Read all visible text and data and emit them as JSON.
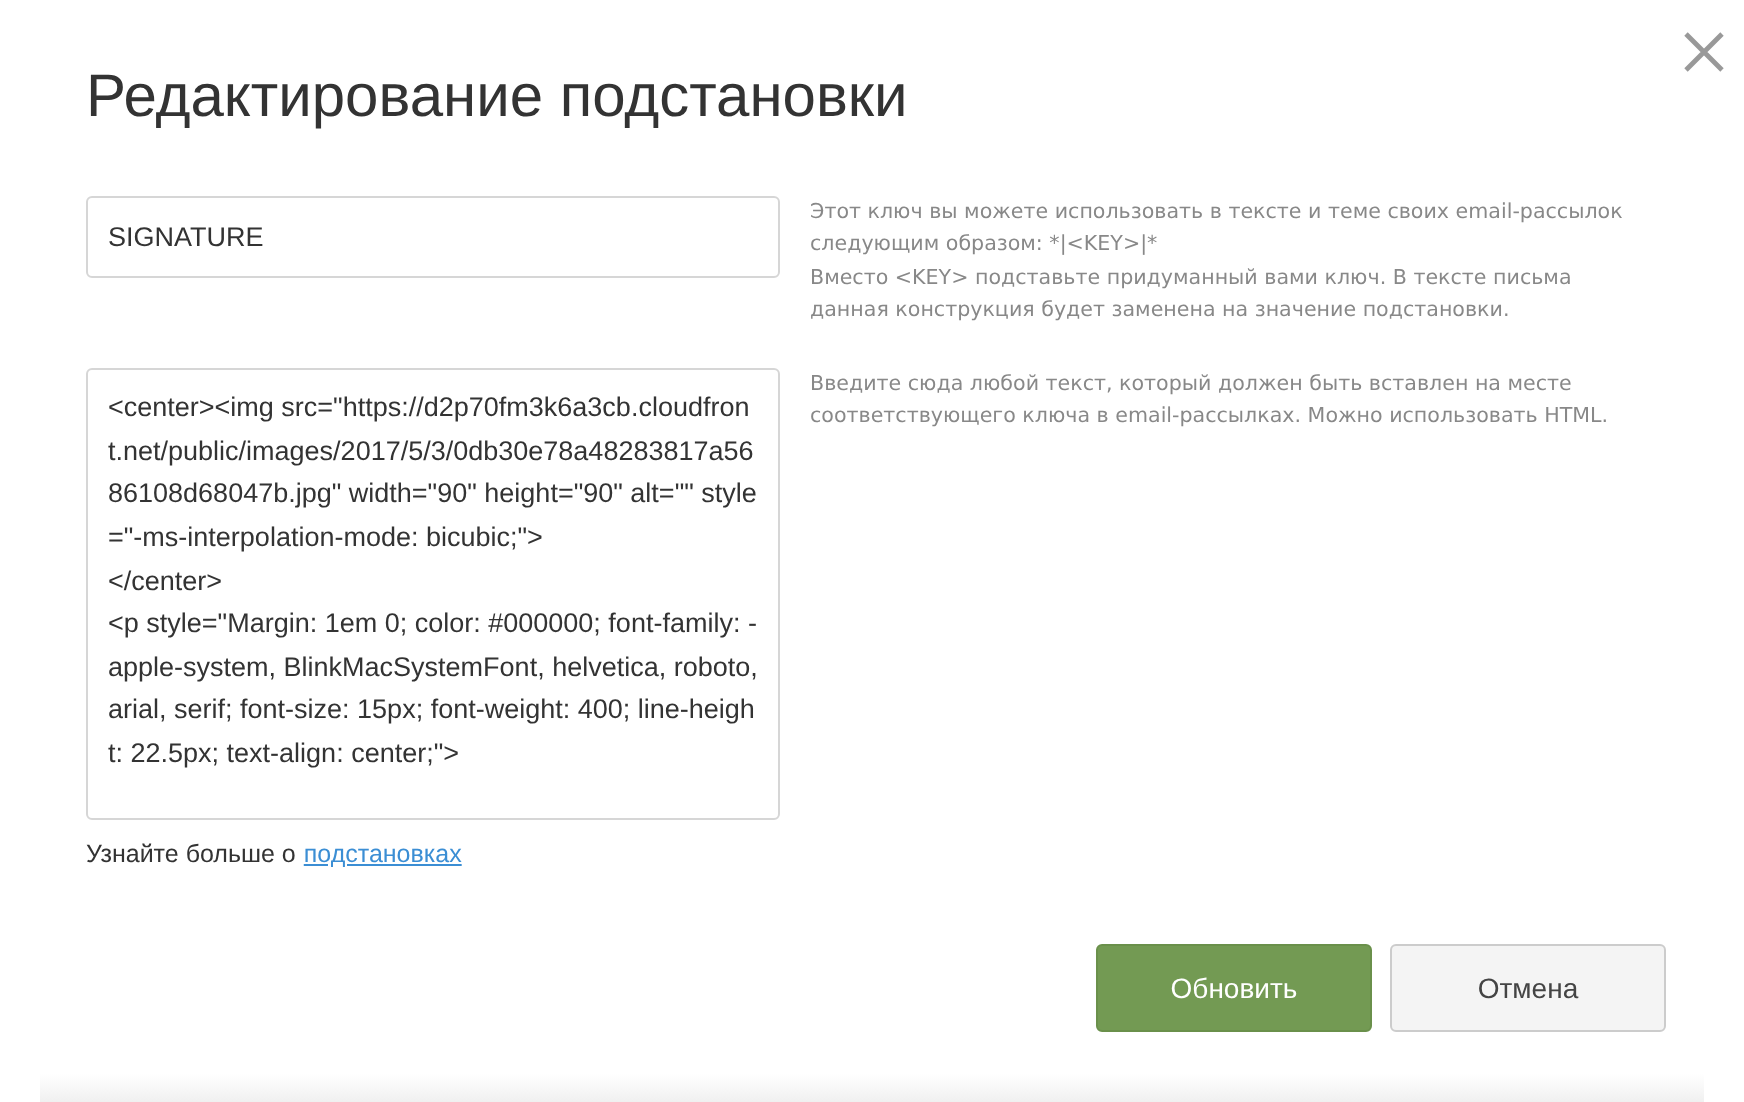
{
  "dialog": {
    "title": "Редактирование подстановки",
    "key_field": {
      "value": "SIGNATURE",
      "help": "Этот ключ вы можете использовать в тексте и теме своих email-рассылок следующим образом: *|<KEY>|*\nВместо <KEY> подставьте придуманный вами ключ. В тексте письма данная конструкция будет заменена на значение подстановки."
    },
    "value_field": {
      "value": "<center><img src=\"https://d2p70fm3k6a3cb.cloudfront.net/public/images/2017/5/3/0db30e78a48283817a5686108d68047b.jpg\" width=\"90\" height=\"90\" alt=\"\" style=\"-ms-interpolation-mode: bicubic;\">\n</center>\n<p style=\"Margin: 1em 0; color: #000000; font-family: -apple-system, BlinkMacSystemFont, helvetica, roboto, arial, serif; font-size: 15px; font-weight: 400; line-height: 22.5px; text-align: center;\">",
      "help": "Введите сюда любой текст, который должен быть вставлен на месте соответствующего ключа в email-рассылках. Можно использовать HTML."
    },
    "learn_more": {
      "text": "Узнайте больше о",
      "link": "подстановках"
    },
    "buttons": [
      {
        "kind": "primary",
        "label": "Обновить"
      },
      {
        "kind": "secondary",
        "label": "Отмена"
      }
    ]
  }
}
